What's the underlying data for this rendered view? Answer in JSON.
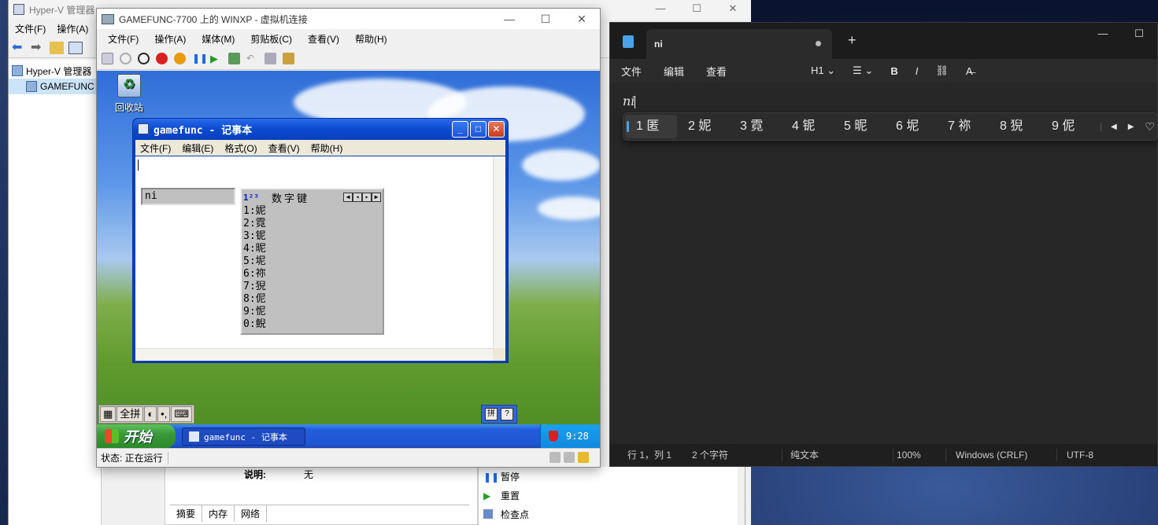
{
  "hyperv": {
    "title": "Hyper-V 管理器",
    "menu": [
      "文件(F)",
      "操作(A)"
    ],
    "tree": [
      "Hyper-V 管理器",
      "GAMEFUNC"
    ],
    "detail_label": "说明:",
    "detail_value": "无",
    "tabs": [
      "摘要",
      "内存",
      "网络"
    ],
    "actions": [
      "暂停",
      "重置",
      "检查点"
    ]
  },
  "vm": {
    "title": "GAMEFUNC-7700 上的 WINXP - 虚拟机连接",
    "menu": [
      "文件(F)",
      "操作(A)",
      "媒体(M)",
      "剪贴板(C)",
      "查看(V)",
      "帮助(H)"
    ],
    "status": "状态: 正在运行",
    "xp": {
      "recycle_label": "回收站",
      "notepad_title": "gamefunc - 记事本",
      "notepad_menu": [
        "文件(F)",
        "编辑(E)",
        "格式(O)",
        "查看(V)",
        "帮助(H)"
      ],
      "ime_composition": "ni",
      "ime_header": "数字键",
      "ime_candidates": [
        "1:妮",
        "2:霓",
        "3:铌",
        "4:昵",
        "5:坭",
        "6:祢",
        "7:猊",
        "8:伲",
        "9:怩",
        "0:鲵"
      ],
      "langbar": [
        "全拼"
      ],
      "start_label": "开始",
      "taskbar_item": "gamefunc - 记事本",
      "clock": "9:28"
    }
  },
  "notepad11": {
    "tab_title": "ni",
    "menu": [
      "文件",
      "编辑",
      "查看"
    ],
    "format": [
      "H1",
      "B",
      "I"
    ],
    "text": "ni",
    "candidates": [
      "1 匿",
      "2 妮",
      "3 霓",
      "4 铌",
      "5 昵",
      "6 坭",
      "7 祢",
      "8 猊",
      "9 伲"
    ],
    "status": [
      "行 1，列 1",
      "2 个字符",
      "纯文本",
      "100%",
      "Windows (CRLF)",
      "UTF-8"
    ]
  }
}
